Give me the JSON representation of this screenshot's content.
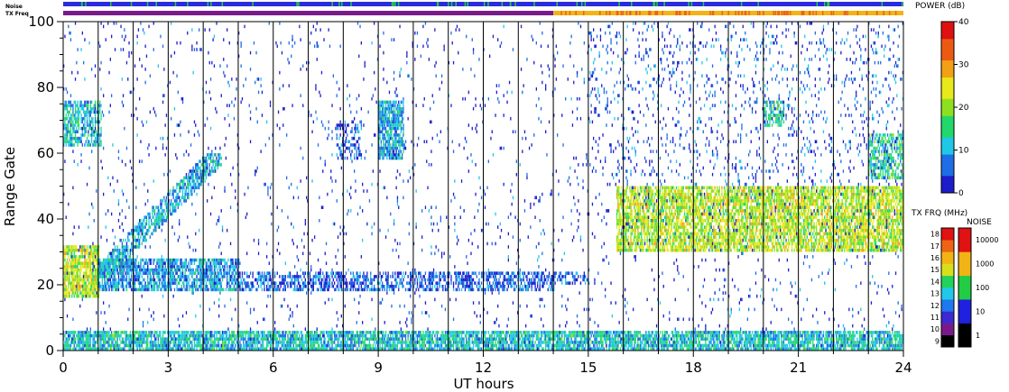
{
  "chart_data": {
    "type": "heatmap",
    "xlabel": "UT hours",
    "ylabel": "Range Gate",
    "x_ticks": [
      "0",
      "3",
      "6",
      "9",
      "12",
      "15",
      "18",
      "21",
      "24"
    ],
    "y_ticks": [
      "0",
      "20",
      "40",
      "60",
      "80",
      "100"
    ],
    "xlim": [
      0,
      24
    ],
    "ylim": [
      0,
      100
    ],
    "scan_boundaries_hours": [
      1,
      2,
      3,
      4,
      5,
      6,
      7,
      8,
      9,
      10,
      11,
      12,
      13,
      14,
      15,
      16,
      17,
      18,
      19,
      20,
      21,
      22,
      23
    ],
    "noise_strip_label": "Noise",
    "tx_strip_label": "TX Freq",
    "tx_frequency_change_hour": 14.0,
    "power_scale": {
      "title": "POWER (dB)",
      "ticks": [
        "0",
        "10",
        "20",
        "30",
        "40"
      ],
      "range": [
        0,
        40
      ],
      "colors": [
        "#1d1dcc",
        "#1e6ee6",
        "#20c8e8",
        "#22d86a",
        "#8de020",
        "#e8e81a",
        "#f2a014",
        "#ec5a12",
        "#e01010"
      ]
    },
    "txfreq_scale": {
      "title": "TX FRQ (MHz)",
      "ticks": [
        "9",
        "10",
        "11",
        "12",
        "13",
        "14",
        "15",
        "16",
        "17",
        "18"
      ],
      "colors": [
        "#000000",
        "#7a1a8a",
        "#3a2ad0",
        "#1e78ee",
        "#22c8e8",
        "#22d25a",
        "#d6e01a",
        "#f2b414",
        "#ee6414",
        "#e01212"
      ]
    },
    "noise_scale": {
      "title": "NOISE",
      "ticks": [
        "1",
        "10",
        "100",
        "1000",
        "10000"
      ],
      "colors": [
        "#000000",
        "#2020e0",
        "#22cc44",
        "#f2b414",
        "#e01212"
      ]
    },
    "echo_regions": [
      {
        "feature": "ground scatter band",
        "t0": 0.0,
        "t1": 24.0,
        "g0": 0,
        "g1": 6,
        "power_dB": 12,
        "density": 0.8
      },
      {
        "feature": "near range band",
        "t0": 0.0,
        "t1": 1.0,
        "g0": 16,
        "g1": 32,
        "power_dB": 22,
        "density": 0.85
      },
      {
        "feature": "range band",
        "t0": 1.0,
        "t1": 5.0,
        "g0": 18,
        "g1": 28,
        "power_dB": 9,
        "density": 0.75
      },
      {
        "feature": "range band",
        "t0": 5.0,
        "t1": 14.0,
        "g0": 18,
        "g1": 24,
        "power_dB": 6,
        "density": 0.55
      },
      {
        "feature": "short band",
        "t0": 14.0,
        "t1": 15.0,
        "g0": 20,
        "g1": 24,
        "power_dB": 5,
        "density": 0.5
      },
      {
        "feature": "rising echo",
        "t0": 1.0,
        "t1": 4.5,
        "g0": 22,
        "g1": 60,
        "power_dB": 10,
        "density": 0.7
      },
      {
        "feature": "patch",
        "t0": 9.0,
        "t1": 9.7,
        "g0": 58,
        "g1": 76,
        "power_dB": 10,
        "density": 0.8
      },
      {
        "feature": "patch",
        "t0": 0.0,
        "t1": 1.1,
        "g0": 62,
        "g1": 76,
        "power_dB": 12,
        "density": 0.6
      },
      {
        "feature": "patch",
        "t0": 7.8,
        "t1": 8.5,
        "g0": 58,
        "g1": 70,
        "power_dB": 5,
        "density": 0.4
      },
      {
        "feature": "strong ionospheric scatter",
        "t0": 15.8,
        "t1": 24.0,
        "g0": 30,
        "g1": 50,
        "power_dB": 22,
        "density": 0.75
      },
      {
        "feature": "patch",
        "t0": 20.0,
        "t1": 20.6,
        "g0": 68,
        "g1": 76,
        "power_dB": 14,
        "density": 0.6
      },
      {
        "feature": "patch",
        "t0": 23.0,
        "t1": 24.0,
        "g0": 52,
        "g1": 66,
        "power_dB": 14,
        "density": 0.6
      },
      {
        "feature": "scattered echoes",
        "t0": 0.0,
        "t1": 24.0,
        "g0": 0,
        "g1": 100,
        "power_dB": 4,
        "density": 0.035
      },
      {
        "feature": "scattered echoes",
        "t0": 15.0,
        "t1": 24.0,
        "g0": 50,
        "g1": 100,
        "power_dB": 6,
        "density": 0.06
      }
    ]
  }
}
